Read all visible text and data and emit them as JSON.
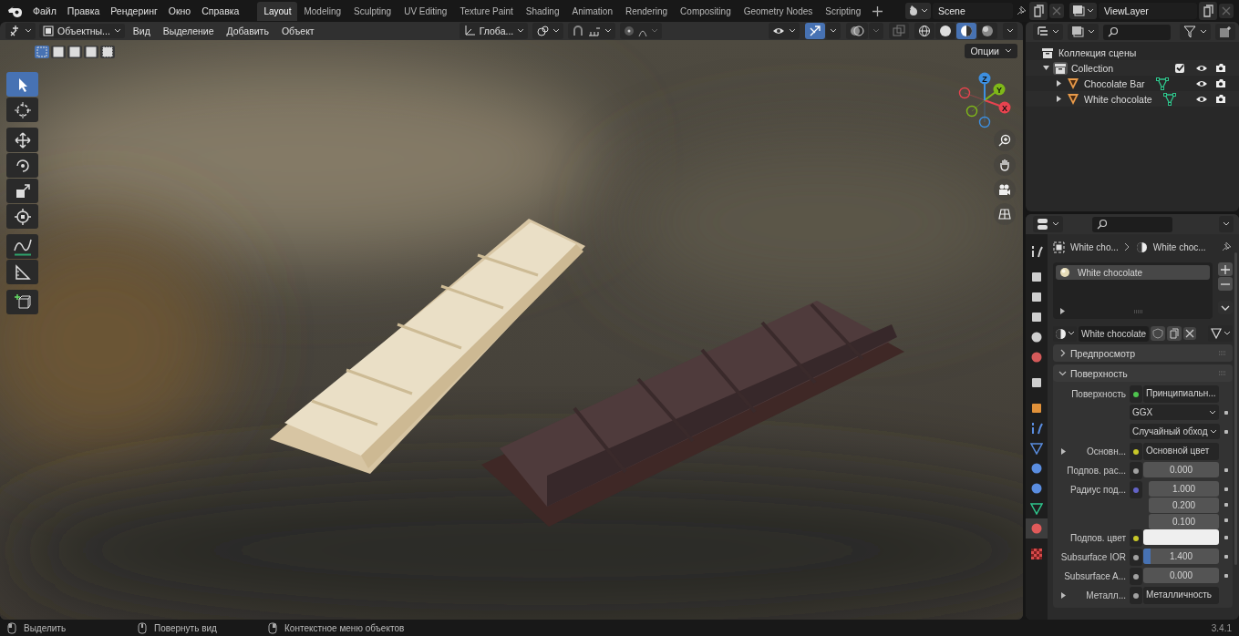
{
  "menu": [
    "Файл",
    "Правка",
    "Рендеринг",
    "Окно",
    "Справка"
  ],
  "workspaces": [
    {
      "label": "Layout",
      "selected": true
    },
    {
      "label": "Modeling",
      "selected": false
    },
    {
      "label": "Sculpting",
      "selected": false
    },
    {
      "label": "UV Editing",
      "selected": false
    },
    {
      "label": "Texture Paint",
      "selected": false
    },
    {
      "label": "Shading",
      "selected": false
    },
    {
      "label": "Animation",
      "selected": false
    },
    {
      "label": "Rendering",
      "selected": false
    },
    {
      "label": "Compositing",
      "selected": false
    },
    {
      "label": "Geometry Nodes",
      "selected": false
    },
    {
      "label": "Scripting",
      "selected": false
    }
  ],
  "scene_selector": {
    "value": "Scene"
  },
  "view_layer_selector": {
    "value": "ViewLayer"
  },
  "viewport": {
    "mode": "Объектны...",
    "menus": [
      "Вид",
      "Выделение",
      "Добавить",
      "Объект"
    ],
    "orientation": "Глоба...",
    "options": "Опции",
    "select_modes": [
      {
        "selected": true
      },
      {
        "selected": false
      },
      {
        "selected": false
      },
      {
        "selected": false
      },
      {
        "selected": false
      }
    ],
    "shading": [
      {
        "kind": "wireframe",
        "selected": false
      },
      {
        "kind": "solid",
        "selected": false
      },
      {
        "kind": "material",
        "selected": true
      },
      {
        "kind": "rendered",
        "selected": false
      }
    ],
    "tools": [
      {
        "kind": "select",
        "selected": true
      },
      {
        "kind": "cursor",
        "selected": false
      },
      {
        "kind": "move",
        "selected": false
      },
      {
        "kind": "rotate",
        "selected": false
      },
      {
        "kind": "scale",
        "selected": false
      },
      {
        "kind": "transform",
        "selected": false
      },
      {
        "kind": "annotate",
        "selected": false
      },
      {
        "kind": "measure",
        "selected": false
      },
      {
        "kind": "add_cube",
        "selected": false
      }
    ],
    "gizmo": [
      {
        "label": "X",
        "color": "#e8434f"
      },
      {
        "label": "Y",
        "color": "#7fb819"
      },
      {
        "label": "Z",
        "color": "#3d8fe0"
      }
    ]
  },
  "outliner": {
    "tree": [
      {
        "name": "Коллекция сцены",
        "kind": "scene_collection",
        "children": [
          {
            "name": "Collection",
            "kind": "collection",
            "expanded": true,
            "checked": true,
            "children": [
              {
                "name": "Chocolate Bar",
                "kind": "object",
                "expanded": false
              },
              {
                "name": "White chocolate",
                "kind": "object",
                "expanded": false
              }
            ]
          }
        ]
      }
    ]
  },
  "properties": {
    "tabs": [
      {
        "kind": "tool",
        "selected": false
      },
      {
        "kind": "render",
        "selected": false
      },
      {
        "kind": "output",
        "selected": false
      },
      {
        "kind": "view_layer",
        "selected": false
      },
      {
        "kind": "scene",
        "selected": false
      },
      {
        "kind": "world",
        "selected": false
      },
      {
        "kind": "collection",
        "selected": false
      },
      {
        "kind": "object",
        "selected": false
      },
      {
        "kind": "modifiers",
        "selected": false
      },
      {
        "kind": "particles",
        "selected": false
      },
      {
        "kind": "physics",
        "selected": false
      },
      {
        "kind": "constraints",
        "selected": false
      },
      {
        "kind": "data",
        "selected": false
      },
      {
        "kind": "material",
        "selected": true
      },
      {
        "kind": "texture",
        "selected": false
      }
    ],
    "breadcrumb": [
      "White cho...",
      "White choc..."
    ],
    "slots": [
      {
        "name": "White chocolate",
        "selected": true
      }
    ],
    "material": "White chocolate",
    "panels": [
      {
        "title": "Предпросмотр",
        "expanded": false
      },
      {
        "title": "Поверхность",
        "expanded": true,
        "rows": [
          {
            "kind": "socket",
            "label": "Поверхность",
            "value": "Принципиальн...",
            "color": "#4ec34e"
          },
          {
            "kind": "dropdown",
            "value": "GGX"
          },
          {
            "kind": "dropdown",
            "value": "Случайный обход"
          },
          {
            "kind": "link",
            "label": "Основн...",
            "value": "Основной цвет",
            "color": "#c7c729"
          },
          {
            "kind": "number",
            "label": "Подпов. рас...",
            "value": "0.000",
            "color": "#a1a1a1"
          },
          {
            "kind": "vector",
            "label": "Радиус под...",
            "values": [
              "1.000",
              "0.200",
              "0.100"
            ],
            "color": "#6363c7"
          },
          {
            "kind": "color",
            "label": "Подпов. цвет",
            "color": "#c7c729"
          },
          {
            "kind": "number",
            "label": "Subsurface IOR",
            "value": "1.400",
            "color": "#a1a1a1",
            "level": 0.1
          },
          {
            "kind": "number",
            "label": "Subsurface A...",
            "value": "0.000",
            "color": "#a1a1a1"
          },
          {
            "kind": "link",
            "label": "Металл...",
            "value": "Металличность",
            "color": "#a1a1a1"
          }
        ]
      }
    ]
  },
  "status_bar": {
    "items": [
      "Выделить",
      "Повернуть вид",
      "Контекстное меню объектов"
    ],
    "version": "3.4.1"
  }
}
